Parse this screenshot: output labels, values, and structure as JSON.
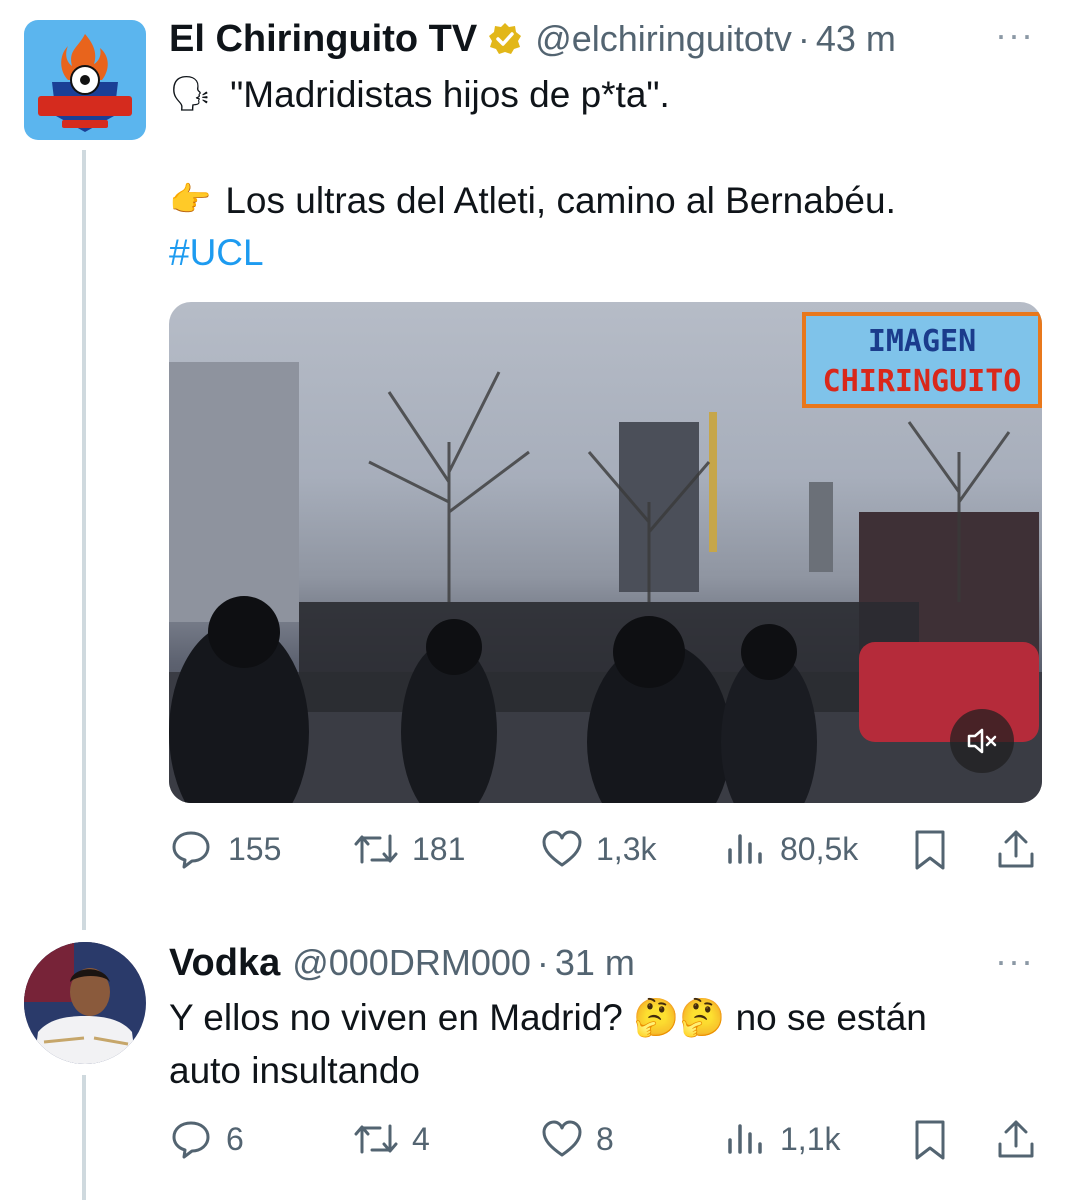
{
  "tweet1": {
    "display_name": "El Chiringuito TV",
    "handle": "@elchiringuitotv",
    "separator": "·",
    "time": "43 m",
    "more": "···",
    "line1_emoji": "🗣",
    "line1_text": "\"Madridistas hijos de p*ta\".",
    "line2_emoji": "👉",
    "line2_text": "Los ultras del Atleti, camino al Bernabéu.",
    "hashtag": "#UCL",
    "media": {
      "overlay_top": "IMAGEN",
      "overlay_bottom": "CHIRINGUITO",
      "icon": "mute-icon"
    },
    "stats": {
      "replies": "155",
      "retweets": "181",
      "likes": "1,3k",
      "views": "80,5k"
    }
  },
  "tweet2": {
    "display_name": "Vodka",
    "handle": "@000DRM000",
    "separator": "·",
    "time": "31 m",
    "more": "···",
    "text_line1": "Y ellos no viven en Madrid? 🤔🤔 no se están",
    "text_line2": "auto insultando",
    "stats": {
      "replies": "6",
      "retweets": "4",
      "likes": "8",
      "views": "1,1k"
    }
  },
  "colors": {
    "link": "#1d9bf0",
    "secondary_text": "#536471",
    "thread_line": "#cfd9de",
    "verified_badge": "#e2b719"
  }
}
